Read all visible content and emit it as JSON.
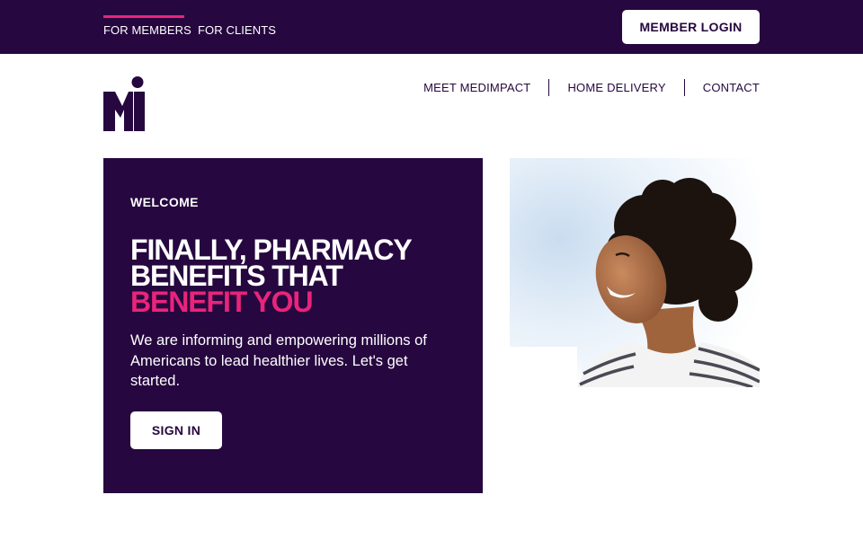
{
  "topbar": {
    "tabs": [
      {
        "label": "FOR MEMBERS",
        "active": true
      },
      {
        "label": "FOR CLIENTS",
        "active": false
      }
    ],
    "login_label": "MEMBER LOGIN"
  },
  "header": {
    "logo_text": "Mi",
    "nav": [
      {
        "label": "MEET MEDIMPACT"
      },
      {
        "label": "HOME DELIVERY"
      },
      {
        "label": "CONTACT"
      }
    ]
  },
  "hero": {
    "eyebrow": "WELCOME",
    "headline_line1": "FINALLY, PHARMACY",
    "headline_line2": "BENEFITS THAT",
    "headline_accent": "BENEFIT YOU",
    "intro": "We are informing and empowering millions of Americans to lead healthier lives. Let's get started.",
    "signin_label": "SIGN IN"
  },
  "colors": {
    "brand_purple": "#26073f",
    "accent_pink": "#e9247b",
    "white": "#ffffff"
  },
  "icons": {
    "logo": "medimpact-mi-logo",
    "hero_image": "smiling-woman-photo"
  }
}
